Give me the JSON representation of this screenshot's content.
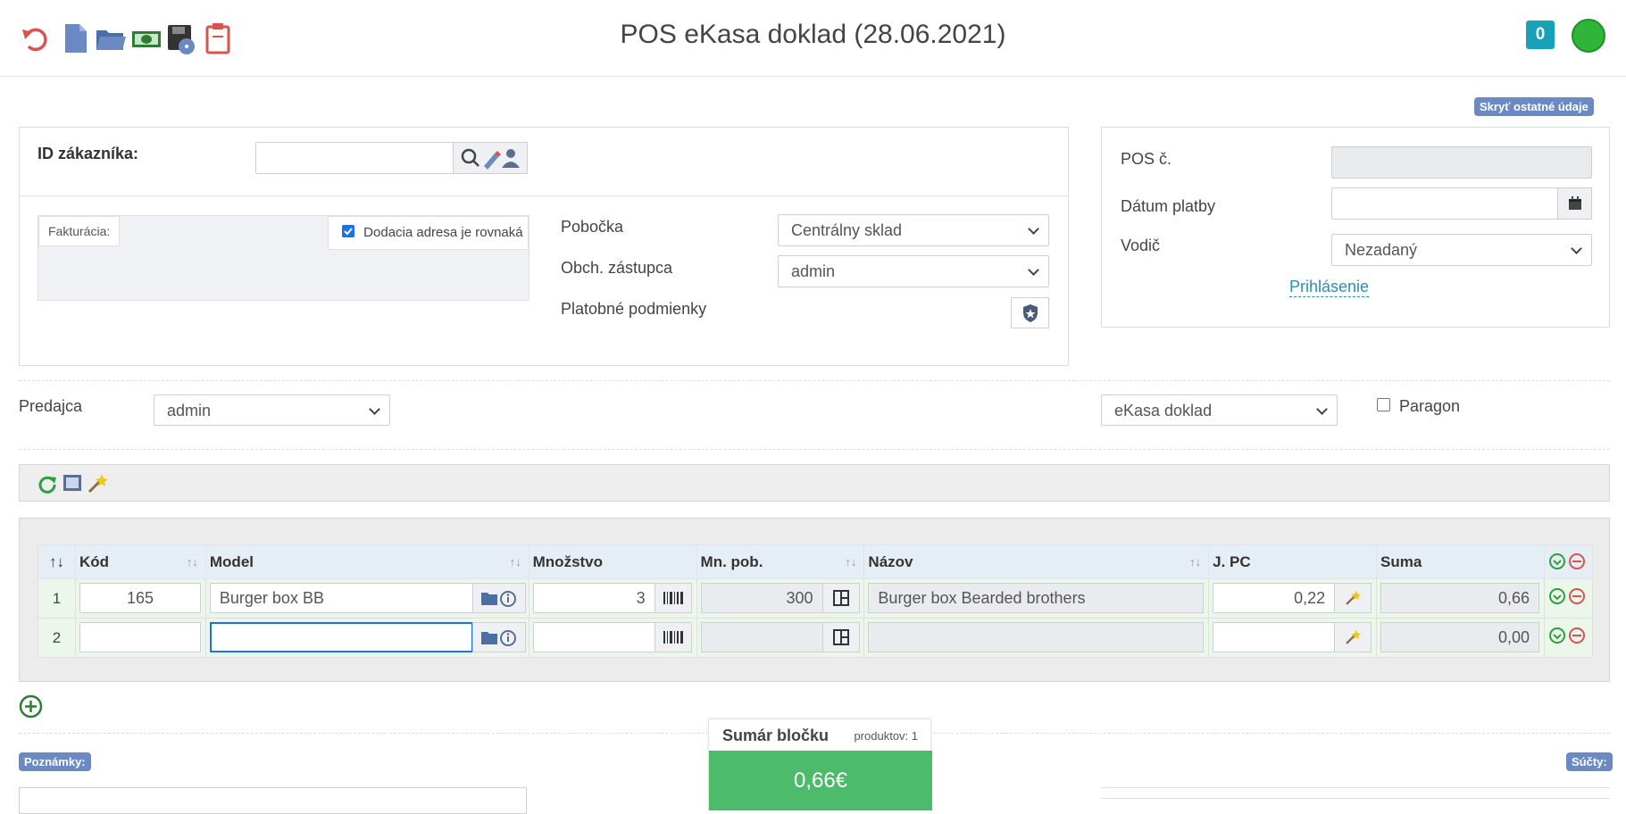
{
  "header": {
    "title": "POS eKasa doklad (28.06.2021)",
    "counter": "0"
  },
  "hide_other_label": "Skryť ostatné údaje",
  "customer": {
    "id_label": "ID zákazníka:",
    "id_value": "",
    "billing_label": "Fakturácia:",
    "delivery_same_label": "Dodacia adresa je rovnaká",
    "delivery_same_checked": true,
    "branch_label": "Pobočka",
    "branch_value": "Centrálny sklad",
    "rep_label": "Obch. zástupca",
    "rep_value": "admin",
    "payment_terms_label": "Platobné podmienky"
  },
  "pos": {
    "pos_no_label": "POS č.",
    "pos_no_value": "",
    "payment_date_label": "Dátum platby",
    "payment_date_value": "",
    "driver_label": "Vodič",
    "driver_value": "Nezadaný",
    "login_link": "Prihlásenie"
  },
  "seller": {
    "label": "Predajca",
    "value": "admin",
    "doc_type_value": "eKasa doklad",
    "paragon_label": "Paragon",
    "paragon_checked": false
  },
  "grid": {
    "columns": [
      "↑↓",
      "Kód",
      "Model",
      "Množstvo",
      "Mn. pob.",
      "Názov",
      "J. PC",
      "Suma"
    ],
    "rows": [
      {
        "num": "1",
        "kod": "165",
        "model": "Burger box BB",
        "mnozstvo": "3",
        "mn_pob": "300",
        "nazov": "Burger box Bearded brothers",
        "jpc": "0,22",
        "suma": "0,66"
      },
      {
        "num": "2",
        "kod": "",
        "model": "",
        "mnozstvo": "",
        "mn_pob": "",
        "nazov": "",
        "jpc": "",
        "suma": "0,00"
      }
    ]
  },
  "footer": {
    "notes_label": "Poznámky:",
    "sums_label": "Súčty:",
    "summary_title": "Sumár bločku",
    "summary_products": "produktov: 1",
    "summary_amount": "0,66€"
  },
  "colors": {
    "accent_blue": "#6b8ac3",
    "teal": "#17a2b8",
    "status_green": "#2fb53a",
    "summary_green": "#4cbb6c"
  }
}
